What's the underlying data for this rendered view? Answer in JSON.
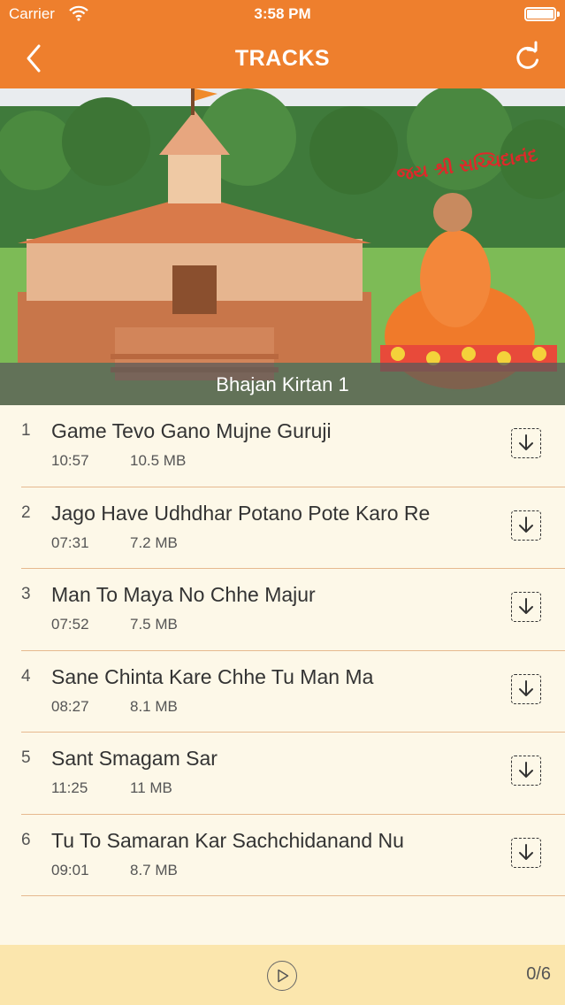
{
  "status_bar": {
    "carrier": "Carrier",
    "time": "3:58 PM"
  },
  "nav": {
    "title": "TRACKS",
    "back_icon": "chevron-left-icon",
    "refresh_icon": "refresh-icon"
  },
  "banner": {
    "caption": "Bhajan Kirtan 1",
    "overlay_text": "જય શ્રી સચ્ચિદાનંદ"
  },
  "tracks": [
    {
      "number": "1",
      "title": "Game Tevo Gano Mujne Guruji",
      "duration": "10:57",
      "size": "10.5 MB"
    },
    {
      "number": "2",
      "title": "Jago Have Udhdhar Potano Pote Karo Re",
      "duration": "07:31",
      "size": "7.2 MB"
    },
    {
      "number": "3",
      "title": "Man To Maya No Chhe Majur",
      "duration": "07:52",
      "size": "7.5 MB"
    },
    {
      "number": "4",
      "title": "Sane Chinta Kare Chhe Tu Man Ma",
      "duration": "08:27",
      "size": "8.1 MB"
    },
    {
      "number": "5",
      "title": "Sant Smagam Sar",
      "duration": "11:25",
      "size": "11 MB"
    },
    {
      "number": "6",
      "title": "Tu To Samaran Kar Sachchidanand Nu",
      "duration": "09:01",
      "size": "8.7 MB"
    }
  ],
  "player": {
    "count": "0/6",
    "play_icon": "play-icon"
  },
  "colors": {
    "accent": "#ee7f2d",
    "list_bg": "#fdf8e8",
    "player_bg": "#fbe6ad",
    "separator": "#e6b98f"
  }
}
